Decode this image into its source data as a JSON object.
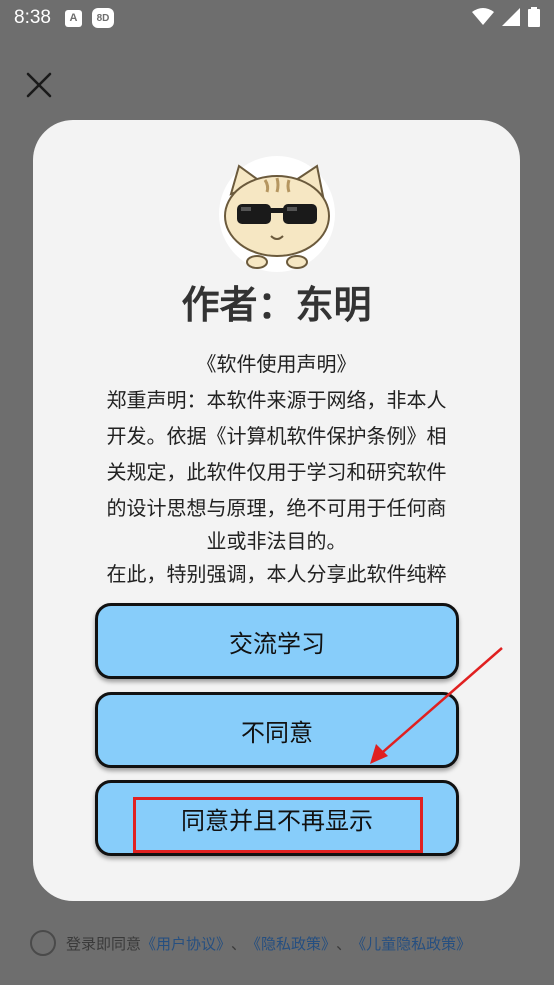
{
  "status_bar": {
    "time": "8:38",
    "notif_icon_1": "A",
    "notif_icon_2": "8D"
  },
  "icons": {
    "close": "close-icon",
    "wifi": "wifi-icon",
    "signal": "signal-icon",
    "battery": "battery-icon",
    "avatar": "cat-sunglasses-avatar"
  },
  "dialog": {
    "author": "作者：东明",
    "statement_lines": [
      "《软件使用声明》",
      "郑重声明：本软件来源于网络，非本人",
      "开发。依据《计算机软件保护条例》相",
      "关规定，此软件仅用于学习和研究软件",
      "的设计思想与原理，绝不可用于任何商",
      "业或非法目的。",
      "在此，特别强调，本人分享此软件纯粹"
    ],
    "buttons": {
      "learn": "交流学习",
      "disagree": "不同意",
      "agree_no_show": "同意并且不再显示"
    }
  },
  "footer": {
    "prefix": "登录即同意",
    "user_agreement": "《用户协议》",
    "sep1": "、",
    "privacy_policy": "《隐私政策》",
    "sep2": "、",
    "child_privacy": "《儿童隐私政策》"
  },
  "colors": {
    "overlay": "#6e6e6e",
    "button": "#87cdfa",
    "highlight": "#e02020",
    "link": "#264f80"
  }
}
